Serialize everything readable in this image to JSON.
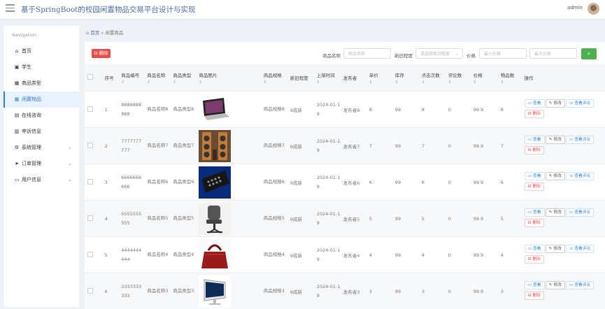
{
  "header": {
    "title": "基于SpringBoot的校园闲置物品交易平台设计与实现",
    "username": "admin"
  },
  "sidebar": {
    "heading": "Navigation",
    "items": [
      {
        "label": "首页",
        "icon": "home-icon",
        "name": "home"
      },
      {
        "label": "学生",
        "icon": "student-icon",
        "name": "student"
      },
      {
        "label": "商品类型",
        "icon": "grid-icon",
        "name": "product-type"
      },
      {
        "label": "闲置物品",
        "icon": "grid-icon",
        "name": "idle-items",
        "active": true
      },
      {
        "label": "在线咨询",
        "icon": "chat-icon",
        "name": "consult"
      },
      {
        "label": "申诉信息",
        "icon": "chart-icon",
        "name": "appeal"
      },
      {
        "label": "系统管理",
        "icon": "settings-icon",
        "name": "system",
        "expandable": true
      },
      {
        "label": "订单管理",
        "icon": "send-icon",
        "name": "orders",
        "expandable": true
      },
      {
        "label": "用户信息",
        "icon": "user-card-icon",
        "name": "user-info",
        "expandable": true
      }
    ]
  },
  "breadcrumb": {
    "home": "首页",
    "separator": "»",
    "current": "闲置商品"
  },
  "toolbar": {
    "delete_label": "删除",
    "name_label": "商品名称",
    "name_placeholder": "商品名称",
    "condition_label": "新旧程度",
    "condition_placeholder": "请选择新旧程度",
    "price_label": "价格",
    "min_placeholder": "最小价格",
    "max_placeholder": "最大价格"
  },
  "table": {
    "columns": [
      {
        "label": "",
        "sortable": false
      },
      {
        "label": "序号",
        "sortable": false
      },
      {
        "label": "商品编号",
        "sortable": true
      },
      {
        "label": "商品名称",
        "sortable": true
      },
      {
        "label": "商品类型",
        "sortable": true
      },
      {
        "label": "商品图片",
        "sortable": true
      },
      {
        "label": "商品规格",
        "sortable": true
      },
      {
        "label": "新旧程度",
        "sortable": false
      },
      {
        "label": "上架时间",
        "sortable": true
      },
      {
        "label": "发布者",
        "sortable": false
      },
      {
        "label": "单价",
        "sortable": true
      },
      {
        "label": "库存",
        "sortable": true
      },
      {
        "label": "点击次数",
        "sortable": true
      },
      {
        "label": "评论数",
        "sortable": true
      },
      {
        "label": "价格",
        "sortable": true
      },
      {
        "label": "物品数",
        "sortable": true
      },
      {
        "label": "操作",
        "sortable": false
      }
    ],
    "rows": [
      {
        "idx": "1",
        "code": "8888888888",
        "name": "商品名称8",
        "type": "商品类型8",
        "image": "laptop",
        "spec": "商品规格8",
        "cond": "9成新",
        "time": "2024-01-19",
        "pub": "发布者8",
        "unit": "8",
        "stock": "99",
        "clicks": "8",
        "comments": "0",
        "price": "99.9",
        "count": "8"
      },
      {
        "idx": "2",
        "code": "7777777777",
        "name": "商品名称7",
        "type": "商品类型7",
        "image": "speakers",
        "spec": "商品规格7",
        "cond": "9成新",
        "time": "2024-01-19",
        "pub": "发布者7",
        "unit": "7",
        "stock": "99",
        "clicks": "7",
        "comments": "0",
        "price": "99.9",
        "count": "7"
      },
      {
        "idx": "3",
        "code": "6666666666",
        "name": "商品名称6",
        "type": "商品类型6",
        "image": "remote",
        "spec": "商品规格6",
        "cond": "9成新",
        "time": "2024-01-19",
        "pub": "发布者6",
        "unit": "6",
        "stock": "99",
        "clicks": "6",
        "comments": "0",
        "price": "99.9",
        "count": "6"
      },
      {
        "idx": "4",
        "code": "5555555555",
        "name": "商品名称5",
        "type": "商品类型5",
        "image": "chair",
        "spec": "商品规格5",
        "cond": "9成新",
        "time": "2024-01-19",
        "pub": "发布者5",
        "unit": "5",
        "stock": "99",
        "clicks": "5",
        "comments": "0",
        "price": "99.9",
        "count": "5"
      },
      {
        "idx": "5",
        "code": "4444444444",
        "name": "商品名称4",
        "type": "商品类型4",
        "image": "handbag",
        "spec": "商品规格4",
        "cond": "9成新",
        "time": "2024-01-19",
        "pub": "发布者4",
        "unit": "4",
        "stock": "99",
        "clicks": "4",
        "comments": "0",
        "price": "99.9",
        "count": "4"
      },
      {
        "idx": "6",
        "code": "3333333333",
        "name": "商品名称3",
        "type": "商品类型3",
        "image": "monitor",
        "spec": "商品规格3",
        "cond": "9成新",
        "time": "2024-01-19",
        "pub": "发布者3",
        "unit": "3",
        "stock": "99",
        "clicks": "3",
        "comments": "0",
        "price": "99.9",
        "count": "3"
      }
    ],
    "actions": {
      "view": "查看",
      "edit": "修改",
      "comments": "查看评论",
      "delete": "删除"
    }
  },
  "colors": {
    "accent": "#2d7fd1",
    "danger": "#e94b4b",
    "success": "#4caf50"
  }
}
